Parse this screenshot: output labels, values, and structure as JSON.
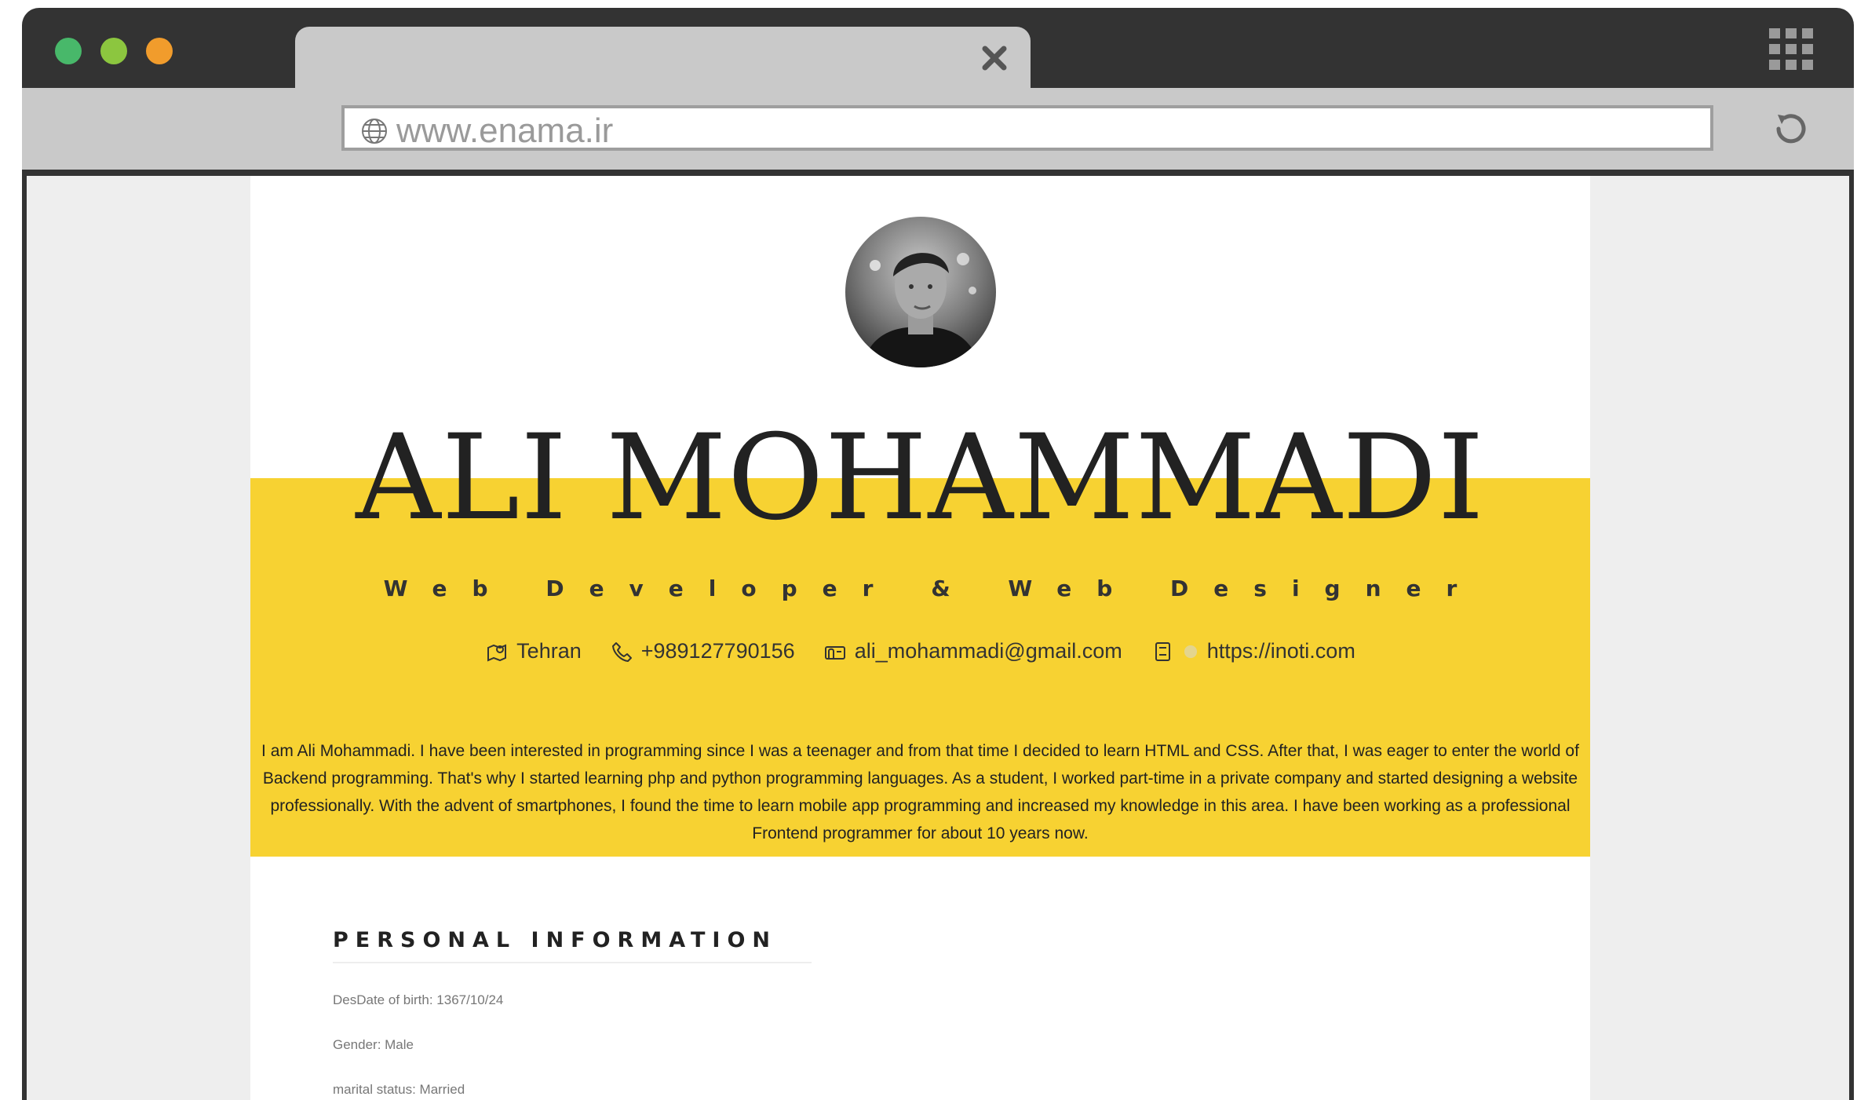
{
  "browser": {
    "url": "www.enama.ir",
    "colors": {
      "close": "#48b86a",
      "minimize": "#8cc63f",
      "maximize": "#f19c2c"
    }
  },
  "profile": {
    "name": "ALI MOHAMMADI",
    "title": "Web Developer & Web Designer",
    "contacts": [
      {
        "icon": "map-icon",
        "text": "Tehran"
      },
      {
        "icon": "phone-icon",
        "text": "+989127790156"
      },
      {
        "icon": "mailbox-icon",
        "text": "ali_mohammadi@gmail.com"
      },
      {
        "icon": "book-icon",
        "text": "https://inoti.com"
      }
    ],
    "bio": "I am Ali Mohammadi. I have been interested in programming since I was a teenager and from that time I decided to learn HTML and CSS. After that, I was eager to enter the world of Backend programming. That's why I started learning php and python programming languages. As a student, I worked part-time in a private company and started designing a website professionally. With the advent of smartphones, I found the time to learn mobile app programming and increased my knowledge in this area. I have been working as a professional Frontend programmer for about 10 years now."
  },
  "personal_information": {
    "heading": "PERSONAL INFORMATION",
    "rows": [
      "DesDate of birth: 1367/10/24",
      "Gender: Male",
      "marital status: Married"
    ]
  },
  "accent_color": "#f7d232"
}
